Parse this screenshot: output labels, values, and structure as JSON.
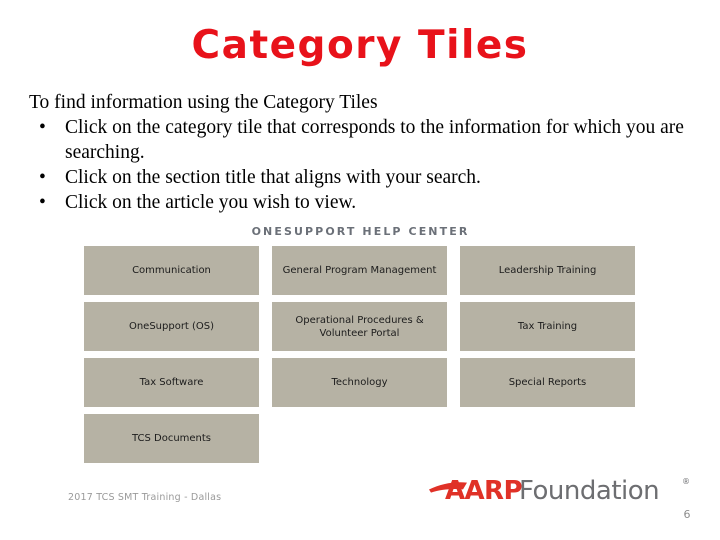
{
  "slide": {
    "title": "Category Tiles",
    "title_color": "#e8121a",
    "page_number": "6"
  },
  "body": {
    "lead": "To find information using the Category Tiles",
    "bullet_glyph": "•",
    "bullets": [
      "Click on the category tile that corresponds to the information for which you are searching.",
      "Click on the section title that aligns with your search.",
      "Click on the article you wish to view."
    ]
  },
  "tile_panel": {
    "header": "ONESUPPORT HELP CENTER",
    "header_color": "#6b7078",
    "tile_color": "#b6b2a4",
    "rows": [
      [
        "Communication",
        "General Program Management",
        "Leadership Training"
      ],
      [
        "OneSupport (OS)",
        "Operational Procedures & Volunteer Portal",
        "Tax Training"
      ],
      [
        "Tax Software",
        "Technology",
        "Special Reports"
      ],
      [
        "TCS Documents",
        "",
        ""
      ]
    ]
  },
  "footer": {
    "note": "2017 TCS SMT Training - Dallas",
    "logo": {
      "brand": "AARP",
      "word": "Foundation",
      "registered": "®",
      "brand_color": "#e03127",
      "word_color": "#6d6e71"
    }
  }
}
